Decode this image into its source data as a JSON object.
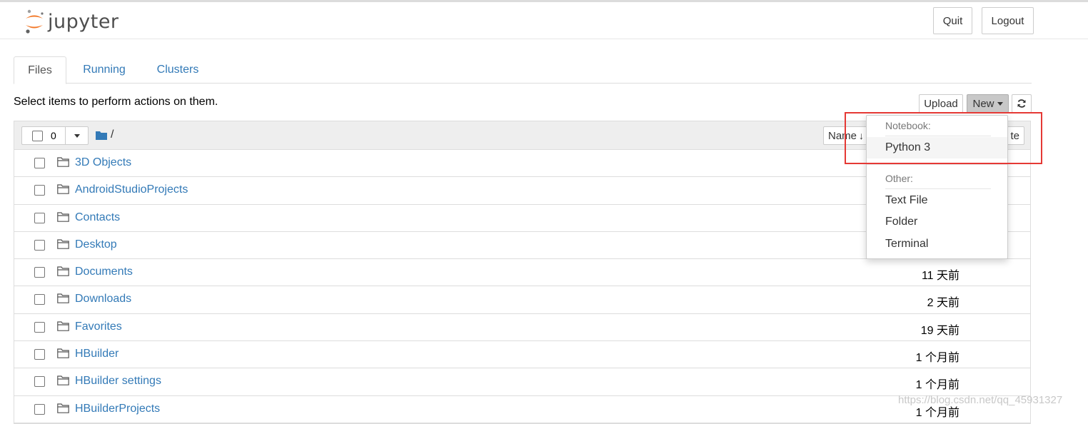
{
  "header": {
    "logo_text": "jupyter",
    "quit_label": "Quit",
    "logout_label": "Logout"
  },
  "tabs": [
    {
      "label": "Files",
      "active": true
    },
    {
      "label": "Running",
      "active": false
    },
    {
      "label": "Clusters",
      "active": false
    }
  ],
  "toolbar": {
    "hint": "Select items to perform actions on them.",
    "upload_label": "Upload",
    "new_label": "New"
  },
  "list": {
    "selected_count": "0",
    "path": "/",
    "sort_label": "Name",
    "modified_label_partial": "te",
    "rows": [
      {
        "name": "3D Objects",
        "time": ""
      },
      {
        "name": "AndroidStudioProjects",
        "time": ""
      },
      {
        "name": "Contacts",
        "time": ""
      },
      {
        "name": "Desktop",
        "time": ""
      },
      {
        "name": "Documents",
        "time": "11 天前"
      },
      {
        "name": "Downloads",
        "time": "2 天前"
      },
      {
        "name": "Favorites",
        "time": "19 天前"
      },
      {
        "name": "HBuilder",
        "time": "1 个月前"
      },
      {
        "name": "HBuilder settings",
        "time": "1 个月前"
      },
      {
        "name": "HBuilderProjects",
        "time": "1 个月前"
      }
    ]
  },
  "new_menu": {
    "notebook_header": "Notebook:",
    "python3": "Python 3",
    "other_header": "Other:",
    "text_file": "Text File",
    "folder": "Folder",
    "terminal": "Terminal"
  },
  "watermark": "https://blog.csdn.net/qq_45931327",
  "colors": {
    "link": "#337ab7",
    "logo_orange": "#f37726",
    "highlight_box": "#e53935"
  }
}
